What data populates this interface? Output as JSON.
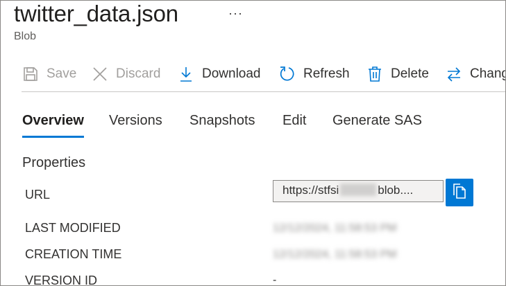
{
  "header": {
    "title": "twitter_data.json",
    "more_label": "···",
    "subtitle": "Blob"
  },
  "toolbar": {
    "save": "Save",
    "discard": "Discard",
    "download": "Download",
    "refresh": "Refresh",
    "delete": "Delete",
    "change": "Chang"
  },
  "tabs": [
    "Overview",
    "Versions",
    "Snapshots",
    "Edit",
    "Generate SAS"
  ],
  "active_tab": "Overview",
  "properties": {
    "section_title": "Properties",
    "url_label": "URL",
    "url_prefix": "https://stfsi",
    "url_suffix": "blob....",
    "last_modified_label": "LAST MODIFIED",
    "last_modified_value": "12/12/2024, 11:58:53 PM",
    "creation_time_label": "CREATION TIME",
    "creation_time_value": "12/12/2024, 11:58:53 PM",
    "version_id_label": "VERSION ID",
    "version_id_value": "-"
  },
  "colors": {
    "accent": "#0078d4",
    "text": "#323130",
    "disabled": "#a19f9d"
  }
}
